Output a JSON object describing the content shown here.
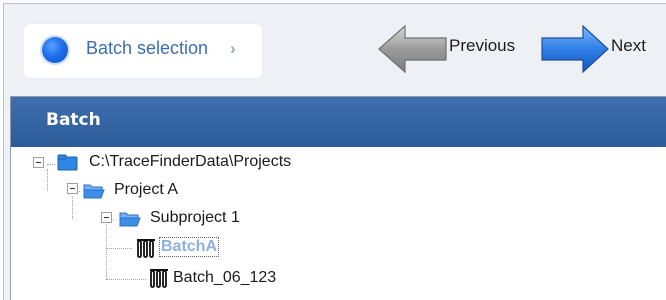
{
  "toolbar": {
    "step_label": "Batch selection",
    "step_chevron": "›",
    "previous_label": "Previous",
    "next_label": "Next"
  },
  "panel": {
    "title": "Batch"
  },
  "tree": {
    "root": "C:\\TraceFinderData\\Projects",
    "project": "Project A",
    "subproject": "Subproject 1",
    "batches": [
      "BatchA",
      "Batch_06_123"
    ],
    "selected": "BatchA"
  }
}
